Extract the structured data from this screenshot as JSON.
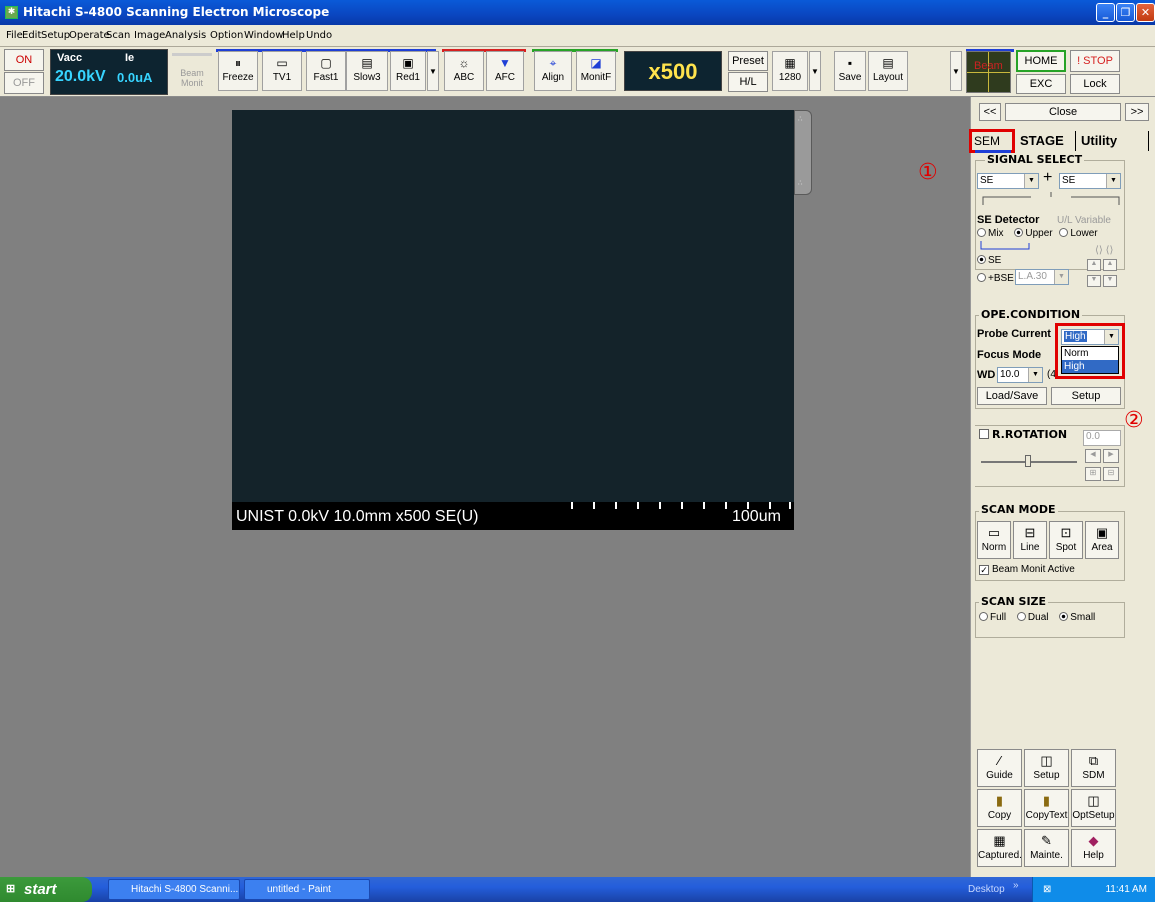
{
  "window": {
    "title": "Hitachi S-4800 Scanning Electron Microscope",
    "minimize": "_",
    "maximize": "❐",
    "close": "✕"
  },
  "menu": [
    "File",
    "Edit",
    "Setup",
    "Operate",
    "Scan",
    "Image",
    "Analysis",
    "Option",
    "Window",
    "Help",
    "Undo"
  ],
  "toolbar": {
    "on": "ON",
    "off": "OFF",
    "vacc_label": "Vacc",
    "ie_label": "Ie",
    "vacc_value": "20.0kV",
    "ie_value": "0.0uA",
    "beam_monit": "Beam\nMonit",
    "freeze": "Freeze",
    "tv1": "TV1",
    "fast1": "Fast1",
    "slow3": "Slow3",
    "red1": "Red1",
    "abc": "ABC",
    "afc": "AFC",
    "align": "Align",
    "monitf": "MonitF",
    "magnification": "x500",
    "preset": "Preset",
    "hl": "H/L",
    "res": "1280",
    "save": "Save",
    "layout": "Layout",
    "beam": "Beam",
    "home": "HOME",
    "stop": "! STOP",
    "exc": "EXC",
    "lock": "Lock",
    "colors": {
      "blue_group": "#1f3fd6",
      "red_group": "#d62020",
      "green_group": "#27a327",
      "mag_text": "#ffe34d",
      "vacc_text": "#37d4ff"
    }
  },
  "image": {
    "caption": "UNIST 0.0kV 10.0mm x500 SE(U)",
    "scale": "100um"
  },
  "panel": {
    "prev": "<<",
    "close": "Close",
    "next": ">>",
    "tabs": [
      "SEM",
      "STAGE",
      "Utility"
    ],
    "signal_select": {
      "legend": "SIGNAL SELECT",
      "left": "SE",
      "right": "SE"
    },
    "se_detector": {
      "label": "SE Detector",
      "variable": "U/L Variable",
      "options": [
        "Mix",
        "Upper",
        "Lower"
      ],
      "selected": "Upper",
      "se": "SE",
      "bse": "+BSE",
      "la": "L.A.30"
    },
    "ope": {
      "legend": "OPE.CONDITION",
      "probe_label": "Probe Current",
      "probe_value": "High",
      "probe_options": [
        "Norm",
        "High"
      ],
      "focus_label": "Focus Mode",
      "wd_label": "WD",
      "wd_value": "10.0",
      "wd_extra": "(4",
      "load_save": "Load/Save",
      "setup": "Setup"
    },
    "rotation": {
      "label": "R.ROTATION",
      "value": "0.0"
    },
    "scan_mode": {
      "legend": "SCAN MODE",
      "buttons": [
        "Norm",
        "Line",
        "Spot",
        "Area"
      ],
      "beam_monit": "Beam Monit Active"
    },
    "scan_size": {
      "legend": "SCAN SIZE",
      "options": [
        "Full",
        "Dual",
        "Small"
      ],
      "selected": "Small"
    },
    "bottom_buttons": [
      "Guide",
      "Setup",
      "SDM",
      "Copy",
      "CopyText",
      "OptSetup",
      "Captured.",
      "Mainte.",
      "Help"
    ]
  },
  "markers": {
    "one": "①",
    "two": "②"
  },
  "taskbar": {
    "start": "start",
    "tasks": [
      "Hitachi S-4800 Scanni...",
      "untitled - Paint"
    ],
    "desktop": "Desktop",
    "time": "11:41 AM"
  }
}
